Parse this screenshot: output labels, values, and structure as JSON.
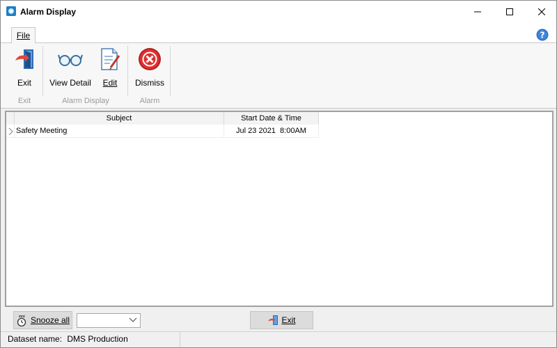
{
  "window": {
    "title": "Alarm Display"
  },
  "ribbon": {
    "tabs": [
      {
        "label": "File",
        "active": true
      }
    ],
    "groups": [
      {
        "label": "Exit",
        "buttons": [
          {
            "label": "Exit",
            "icon": "exit-door-icon"
          }
        ]
      },
      {
        "label": "Alarm Display",
        "buttons": [
          {
            "label": "View Detail",
            "icon": "glasses-icon"
          },
          {
            "label": "Edit",
            "icon": "edit-document-icon"
          }
        ]
      },
      {
        "label": "Alarm",
        "buttons": [
          {
            "label": "Dismiss",
            "icon": "dismiss-x-icon"
          }
        ]
      }
    ]
  },
  "grid": {
    "columns": [
      "Subject",
      "Start Date & Time"
    ],
    "rows": [
      {
        "subject": "Safety Meeting",
        "start": "Jul 23 2021  8:00AM"
      }
    ]
  },
  "footer": {
    "snooze_label": "Snooze all",
    "snooze_select_value": "",
    "exit_label": "Exit"
  },
  "status": {
    "dataset_label": "Dataset name:",
    "dataset_value": "DMS Production"
  },
  "colors": {
    "dismiss_red": "#e03030",
    "help_blue": "#2d6fc4",
    "group_label_gray": "#9a9a9a"
  }
}
